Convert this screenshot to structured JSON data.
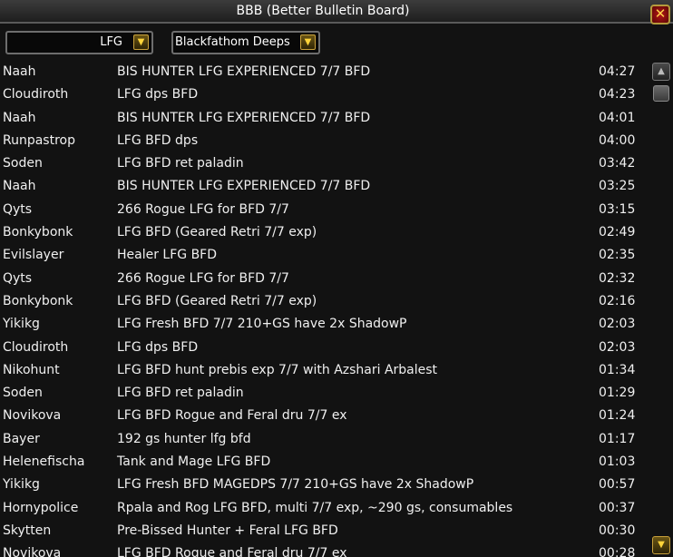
{
  "window": {
    "title": "BBB (Better Bulletin Board)",
    "close_symbol": "✕"
  },
  "filters": {
    "category": {
      "value": "LFG",
      "arrow": "▼"
    },
    "dungeon": {
      "value": "Blackfathom Deeps",
      "arrow": "▼"
    }
  },
  "messages": [
    {
      "name": "Naah",
      "text": "BIS HUNTER LFG EXPERIENCED 7/7 BFD",
      "time": "04:27"
    },
    {
      "name": "Cloudiroth",
      "text": "LFG dps BFD",
      "time": "04:23"
    },
    {
      "name": "Naah",
      "text": "BIS HUNTER LFG EXPERIENCED 7/7 BFD",
      "time": "04:01"
    },
    {
      "name": "Runpastrop",
      "text": "LFG BFD dps",
      "time": "04:00"
    },
    {
      "name": "Soden",
      "text": "LFG BFD ret paladin",
      "time": "03:42"
    },
    {
      "name": "Naah",
      "text": "BIS HUNTER LFG EXPERIENCED 7/7 BFD",
      "time": "03:25"
    },
    {
      "name": "Qyts",
      "text": "266 Rogue LFG for BFD 7/7",
      "time": "03:15"
    },
    {
      "name": "Bonkybonk",
      "text": "LFG BFD (Geared Retri 7/7 exp)",
      "time": "02:49"
    },
    {
      "name": "Evilslayer",
      "text": "Healer LFG BFD",
      "time": "02:35"
    },
    {
      "name": "Qyts",
      "text": "266 Rogue LFG for BFD 7/7",
      "time": "02:32"
    },
    {
      "name": "Bonkybonk",
      "text": "LFG BFD (Geared Retri 7/7 exp)",
      "time": "02:16"
    },
    {
      "name": "Yikikg",
      "text": "LFG Fresh BFD 7/7 210+GS have 2x ShadowP",
      "time": "02:03"
    },
    {
      "name": "Cloudiroth",
      "text": "LFG dps BFD",
      "time": "02:03"
    },
    {
      "name": "Nikohunt",
      "text": "LFG BFD hunt prebis exp 7/7 with Azshari Arbalest",
      "time": "01:34"
    },
    {
      "name": "Soden",
      "text": "LFG BFD ret paladin",
      "time": "01:29"
    },
    {
      "name": "Novikova",
      "text": "LFG BFD Rogue and Feral dru 7/7 ex",
      "time": "01:24"
    },
    {
      "name": "Bayer",
      "text": "192 gs hunter lfg bfd",
      "time": "01:17"
    },
    {
      "name": "Helenefischa",
      "text": "Tank and Mage LFG BFD",
      "time": "01:03"
    },
    {
      "name": "Yikikg",
      "text": "LFG Fresh BFD MAGEDPS 7/7 210+GS have 2x ShadowP",
      "time": "00:57"
    },
    {
      "name": "Hornypolice",
      "text": "Rpala and Rog LFG BFD, multi 7/7 exp, ~290 gs, consumables",
      "time": "00:37"
    },
    {
      "name": "Skytten",
      "text": "Pre-Bissed Hunter + Feral LFG BFD",
      "time": "00:30"
    },
    {
      "name": "Novikova",
      "text": "LFG BFD Rogue and Feral dru 7/7 ex",
      "time": "00:28"
    }
  ],
  "scrollbar": {
    "up_symbol": "▲",
    "down_symbol": "▼"
  }
}
